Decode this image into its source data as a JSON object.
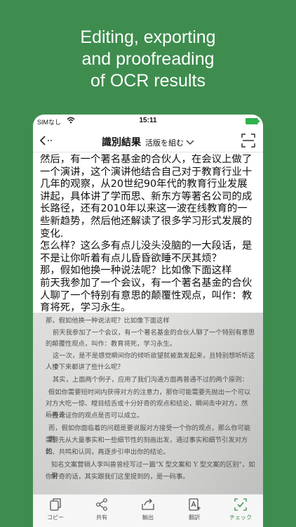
{
  "headline": {
    "line1": "Editing, exporting",
    "line2": "and proofreading",
    "line3": "of OCR results"
  },
  "status_bar": {
    "carrier": "SIMなし",
    "time": "15:11"
  },
  "nav": {
    "title": "識別結果",
    "layout_label": "活版を組む",
    "layout_chevron": "chevron-down-icon"
  },
  "ocr_text": "然后，有一个著名基金的合伙人，在会议上做了一个演讲，这个演讲他结合自己对于教育行业十几年的观察，从20世纪90年代的教育行业发展讲起，具体讲了学而思、新东方等著名公司的成长路径，还有2010年以来这一波在线教育的一些新趋势，然后他还解读了很多学习形式发展的变化.\n怎么样？这么多有点儿没头没脑的一大段话，是不是让你听着有点儿昏昏欲睡不厌其烦？\n那，假如他换一种说法呢？比如像下面这样\n前天我参加了一个会议，有一个著名基金的合伙人聊了一个特别有意思的颠覆性观点，叫作：教育将死，学习永生。\n这一次，是不是感觉瞬间你的倾听欲望就被激发起来，且特别想听听这个人接下来都讲了些什么",
  "photo": {
    "lines": [
      "那，假如他换一种说法呢？比如像下面这样",
      "前天我参加了一个会议，有一个著名基金的合伙人聊了一个特别有意思",
      "的颠覆性观点，叫作：教育将死，学习永生。",
      "这一次，是不是感觉瞬间你的倾听欲望就被激发起来，且特别想听听这个",
      "人接下来都讲了些什么呢？",
      "其实，上面两个例子，应用了我们沟通方面再普通不过的两个原则：",
      "假如你需要短时间内获得对方的注意力，那你可能需要先抛出一个可以",
      "对方大吃一惊、瞠目结舌或十分好奇的观点和结论，瞬间击中对方。然后再去",
      "一些论证你的观点是否可以成立。",
      "而，假如你面临着的问题是要说服对方接受一个你的观点，那么你可能更",
      "需要先从大量事实和一些细节性的刻画出发，通过事实和细节引发对方的",
      "如、共鸣和认同，再逐步引申出你的结论。",
      "知名文案营销人李叫兽曾经写过一篇\"X 型文案和 Y 型文案的区别\"，如果",
      "你好奇的话，其实跟我们这里提到的，是一码事。"
    ]
  },
  "toolbar": {
    "items": [
      {
        "label": "コピー",
        "icon": "copy-icon"
      },
      {
        "label": "共有",
        "icon": "share-icon"
      },
      {
        "label": "輸出",
        "icon": "export-icon"
      },
      {
        "label": "翻訳",
        "icon": "translate-icon"
      },
      {
        "label": "チェック",
        "icon": "check-icon"
      }
    ],
    "active_color": "#3e8d4f"
  },
  "colors": {
    "background": "#3e8d4f",
    "battery": "#2fb24a"
  }
}
